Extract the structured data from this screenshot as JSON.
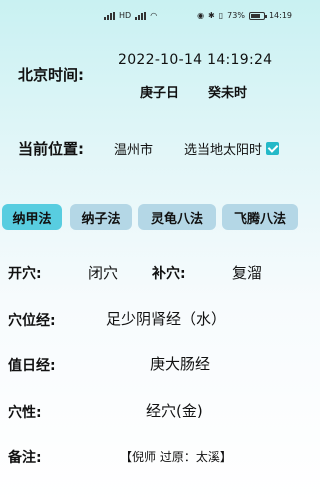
{
  "status_bar": {
    "left_indicators": "HD",
    "battery_percent": "73%",
    "battery_level": 0.73,
    "time": "14:19"
  },
  "beijing_time": {
    "label": "北京时间:",
    "datetime": "2022-10-14 14:19:24",
    "day_ganzhi": "庚子日",
    "hour_ganzhi": "癸未时"
  },
  "location": {
    "label": "当前位置:",
    "city": "温州市",
    "solar_time_label": "选当地太阳时",
    "solar_time_checked": true
  },
  "tabs": [
    {
      "label": "纳甲法",
      "active": true
    },
    {
      "label": "纳子法",
      "active": false
    },
    {
      "label": "灵龟八法",
      "active": false
    },
    {
      "label": "飞腾八法",
      "active": false
    }
  ],
  "result": {
    "open_label": "开穴:",
    "open_value": "闭穴",
    "supplement_label": "补穴:",
    "supplement_value": "复溜",
    "meridian_label": "穴位经:",
    "meridian_value": "足少阴肾经（水）",
    "duty_label": "值日经:",
    "duty_value": "庚大肠经",
    "nature_label": "穴性:",
    "nature_value": "经穴(金)",
    "note_label": "备注:",
    "note_value": "【倪师 过原：太溪】"
  },
  "colors": {
    "accent": "#24b9c8",
    "tab_active": "#58cde0",
    "tab_inactive": "#b4d7e6"
  }
}
